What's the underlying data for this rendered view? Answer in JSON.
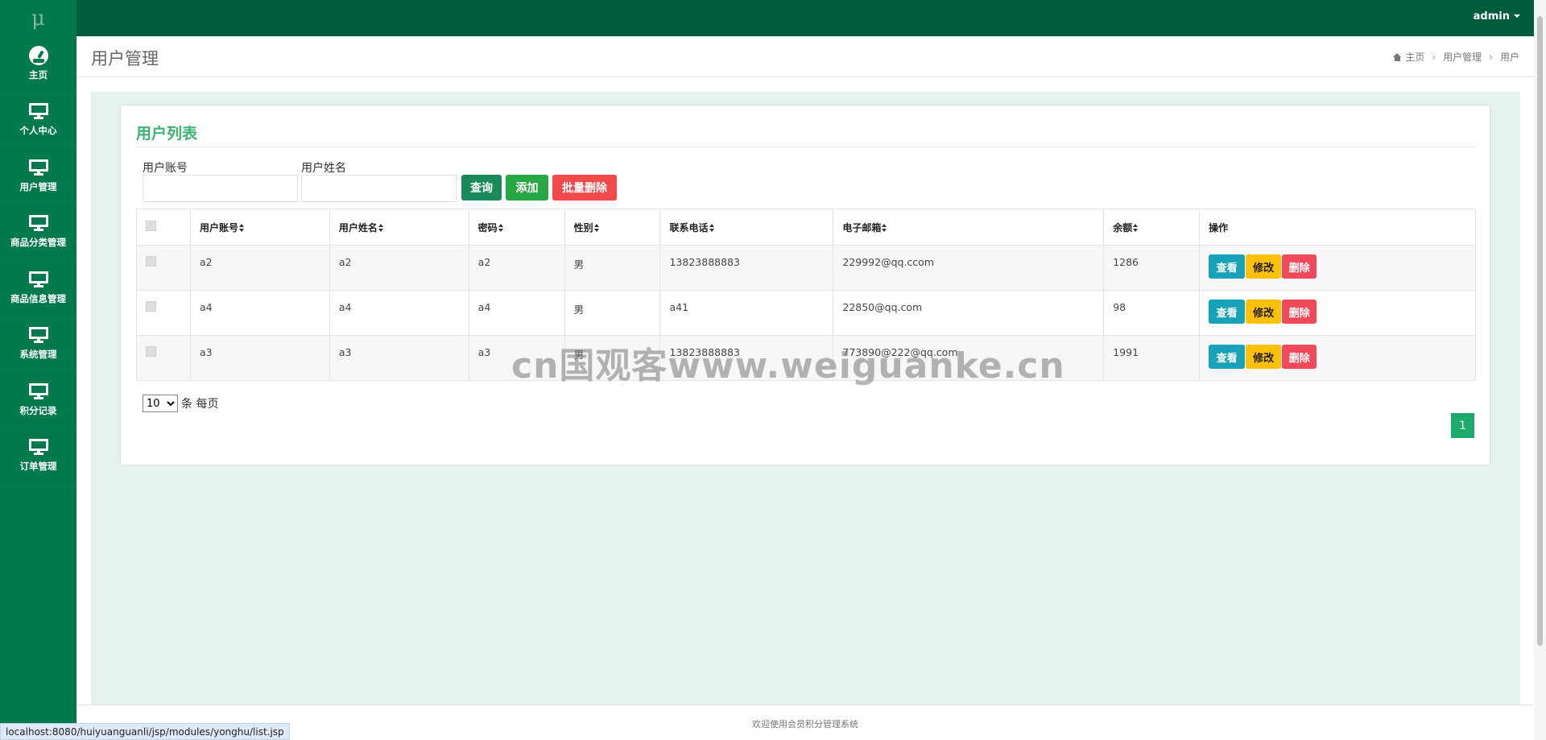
{
  "app": {
    "logo": "μ",
    "user": "admin"
  },
  "sidebar": {
    "items": [
      {
        "label": "主页",
        "icon": "dashboard-icon"
      },
      {
        "label": "个人中心",
        "icon": "monitor-icon"
      },
      {
        "label": "用户管理",
        "icon": "monitor-icon"
      },
      {
        "label": "商品分类管理",
        "icon": "monitor-icon"
      },
      {
        "label": "商品信息管理",
        "icon": "monitor-icon"
      },
      {
        "label": "系统管理",
        "icon": "monitor-icon"
      },
      {
        "label": "积分记录",
        "icon": "monitor-icon"
      },
      {
        "label": "订单管理",
        "icon": "monitor-icon"
      }
    ]
  },
  "header": {
    "title": "用户管理",
    "breadcrumb": [
      "主页",
      "用户管理",
      "用户"
    ]
  },
  "card": {
    "title": "用户列表",
    "search": {
      "account_label": "用户账号",
      "account_value": "",
      "name_label": "用户姓名",
      "name_value": ""
    },
    "buttons": {
      "query": "查询",
      "add": "添加",
      "batch_delete": "批量删除"
    }
  },
  "table": {
    "headers": [
      "用户账号",
      "用户姓名",
      "密码",
      "性别",
      "联系电话",
      "电子邮箱",
      "余额",
      "操作"
    ],
    "rows": [
      {
        "account": "a2",
        "name": "a2",
        "password": "a2",
        "gender": "男",
        "phone": "13823888883",
        "email": "229992@qq.ccom",
        "balance": "1286"
      },
      {
        "account": "a4",
        "name": "a4",
        "password": "a4",
        "gender": "男",
        "phone": "a41",
        "email": "22850@qq.com",
        "balance": "98"
      },
      {
        "account": "a3",
        "name": "a3",
        "password": "a3",
        "gender": "男",
        "phone": "13823888883",
        "email": "773890@222@qq.com",
        "balance": "1991"
      }
    ],
    "actions": {
      "view": "查看",
      "edit": "修改",
      "delete": "删除"
    }
  },
  "pagination": {
    "page_size": "10",
    "page_size_suffix": "条 每页",
    "current_page": "1"
  },
  "watermark": "cn国观客www.weiguanke.cn",
  "footer": {
    "text": "欢迎使用会员积分管理系统"
  },
  "status_bar": {
    "url": "localhost:8080/huiyuanguanli/jsp/modules/yonghu/list.jsp"
  },
  "colors": {
    "topbar": "#005c3f",
    "sidebar": "#007a4d",
    "accent_title": "#3cb371",
    "content_bg": "#e6f2ec",
    "view": "#17a2b8",
    "edit": "#ffc107",
    "delete": "#f04a5a"
  }
}
